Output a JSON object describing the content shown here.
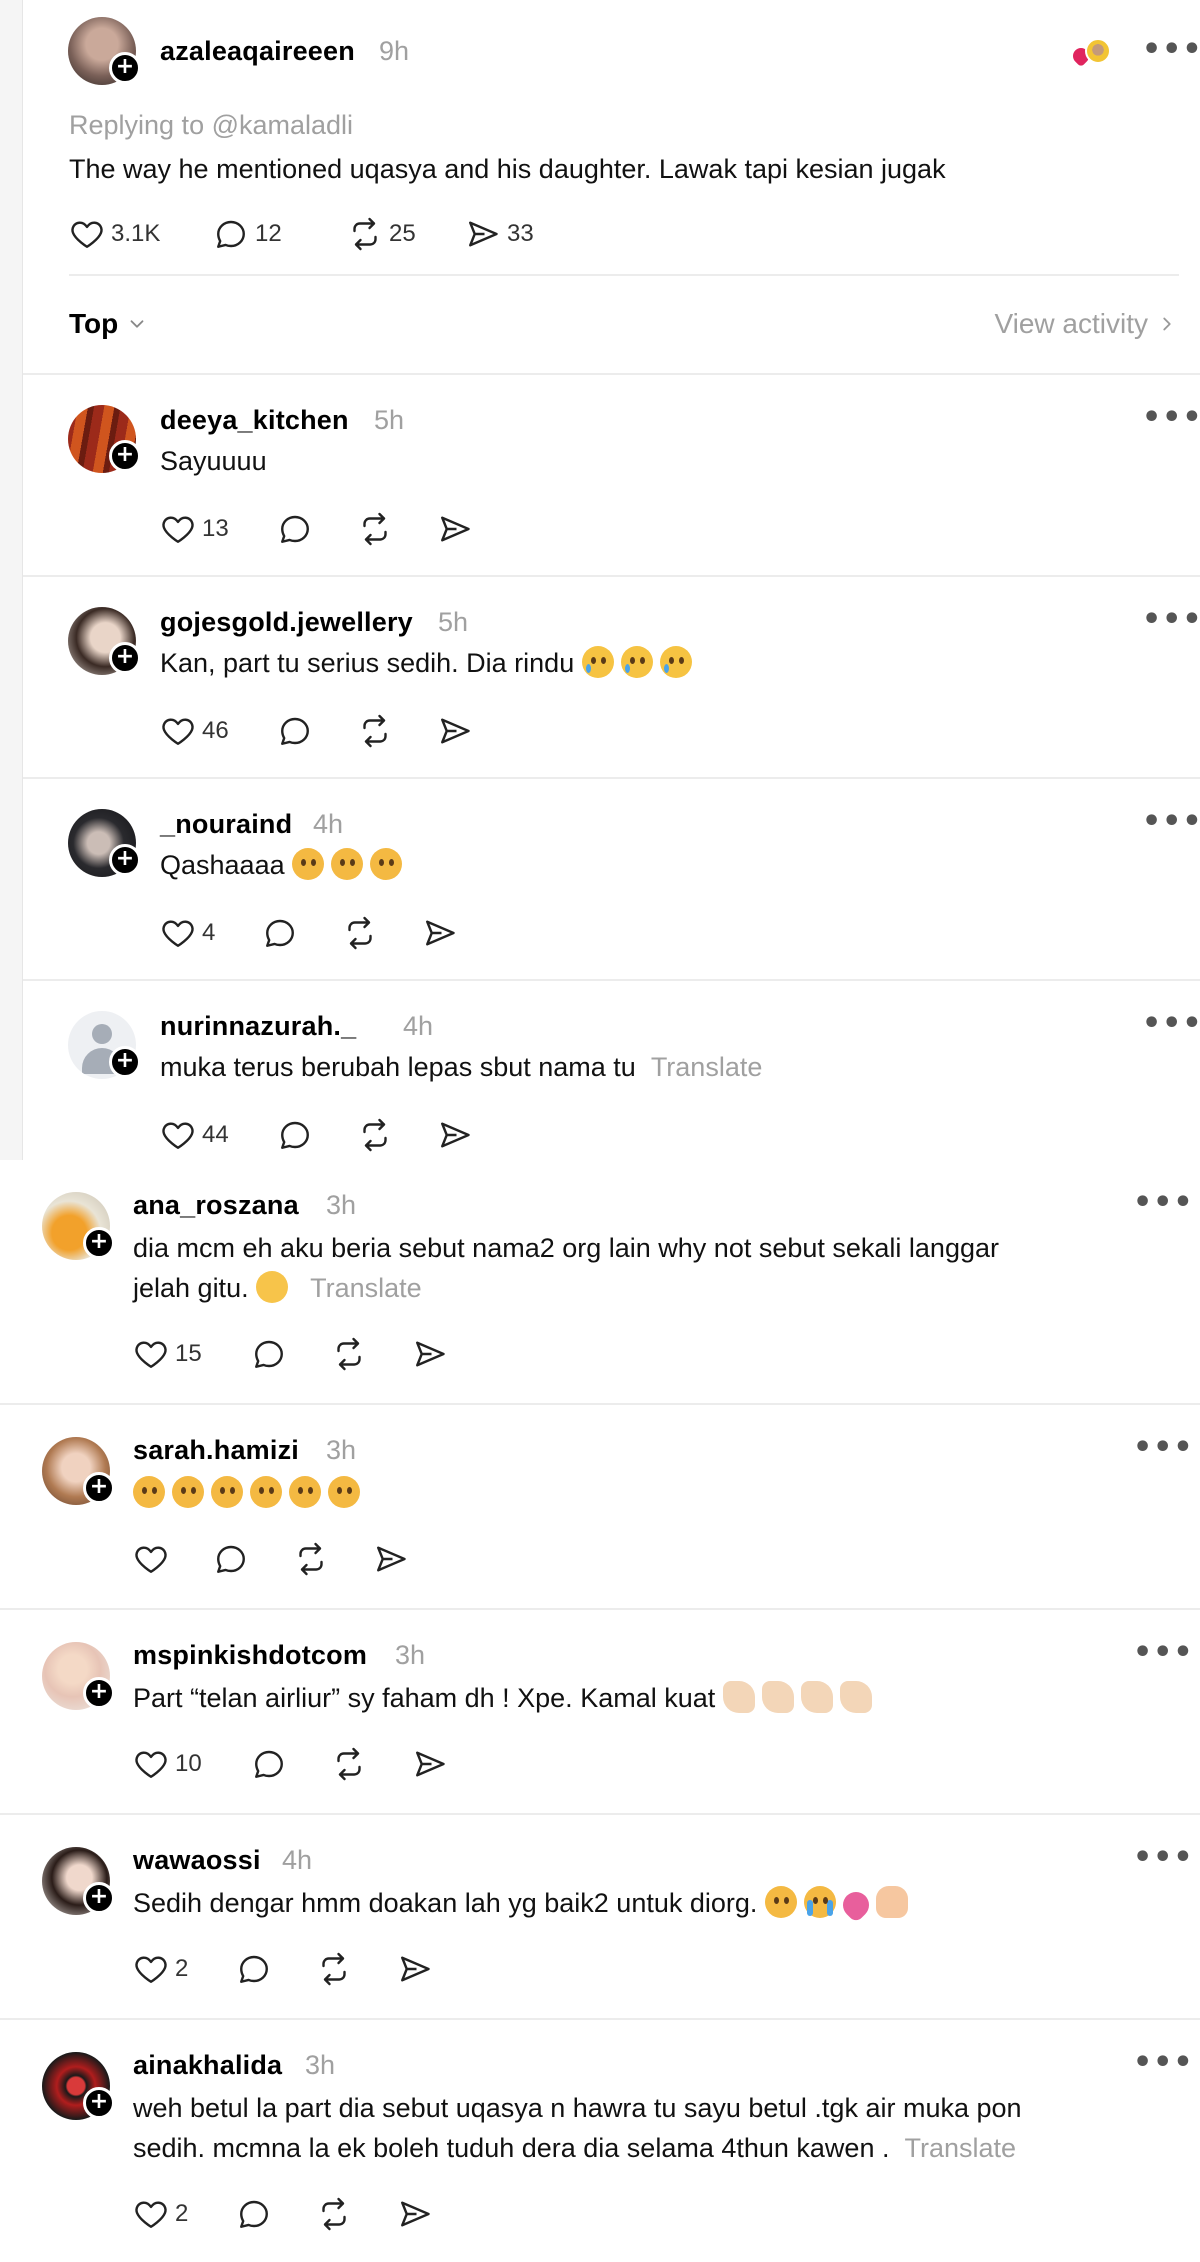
{
  "main_post": {
    "username": "azaleaqaireeen",
    "time": "9h",
    "replying_to": "Replying to @kamaladli",
    "text": "The way he mentioned uqasya and his daughter. Lawak tapi kesian jugak",
    "likes": "3.1K",
    "replies": "12",
    "reposts": "25",
    "shares": "33"
  },
  "sort_bar": {
    "sort_label": "Top",
    "view_activity": "View activity"
  },
  "replies_a": [
    {
      "username": "deeya_kitchen",
      "time": "5h",
      "text": "Sayuuuu",
      "likes": "13",
      "emoji": []
    },
    {
      "username": "gojesgold.jewellery",
      "time": "5h",
      "text": "Kan, part tu serius sedih. Dia rindu",
      "likes": "46",
      "emoji": [
        "cry",
        "cry",
        "cry"
      ]
    },
    {
      "username": "_nouraind",
      "time": "4h",
      "text": "Qashaaaa",
      "likes": "4",
      "emoji": [
        "plead",
        "plead",
        "plead"
      ]
    },
    {
      "username": "nurinnazurah._",
      "time": "4h",
      "text": "muka terus berubah lepas sbut nama tu",
      "translate": "Translate",
      "likes": "44",
      "emoji": []
    }
  ],
  "replies_b": [
    {
      "username": "ana_roszana",
      "time": "3h",
      "text_line1": "dia mcm eh aku beria sebut nama2 org lain why not sebut sekali langgar",
      "text_line2": "jelah gitu.",
      "translate": "Translate",
      "likes": "15"
    },
    {
      "username": "sarah.hamizi",
      "time": "3h",
      "likes": ""
    },
    {
      "username": "mspinkishdotcom",
      "time": "3h",
      "text": "Part “telan airliur” sy faham dh ! Xpe. Kamal kuat",
      "likes": "10"
    },
    {
      "username": "wawaossi",
      "time": "4h",
      "text": "Sedih dengar hmm doakan lah yg baik2 untuk diorg.",
      "likes": "2"
    },
    {
      "username": "ainakhalida",
      "time": "3h",
      "text_line1": "weh betul la part dia sebut uqasya n hawra tu sayu betul .tgk air muka pon",
      "text_line2": "sedih. mcmna la ek boleh tuduh dera dia selama 4thun kawen .",
      "translate": "Translate",
      "likes": "2"
    }
  ],
  "colors": {
    "text_secondary": "#a0a0a0",
    "divider": "#ececec",
    "follow_badge": "#000000"
  }
}
